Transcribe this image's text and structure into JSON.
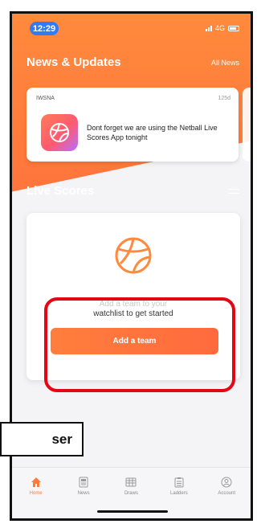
{
  "status_bar": {
    "time": "12:29",
    "network": "4G"
  },
  "news": {
    "title": "News & Updates",
    "all_label": "All News",
    "card": {
      "source": "IWSNA",
      "age": "125d",
      "text": "Dont forget we are using the Netball Live Scores App tonight"
    }
  },
  "live_scores": {
    "title": "Live Scores",
    "empty_text_line1": "Add a team to your",
    "empty_text_line2": "watchlist to get started",
    "add_button_label": "Add a team"
  },
  "annotation": {
    "callout_text": "ser"
  },
  "bottom_nav": {
    "items": [
      {
        "label": "Home",
        "icon": "home-icon",
        "active": true
      },
      {
        "label": "News",
        "icon": "news-icon",
        "active": false
      },
      {
        "label": "Draws",
        "icon": "draws-icon",
        "active": false
      },
      {
        "label": "Ladders",
        "icon": "ladders-icon",
        "active": false
      },
      {
        "label": "Account",
        "icon": "account-icon",
        "active": false
      }
    ]
  },
  "colors": {
    "accent": "#ff7a3b",
    "highlight": "#e40613",
    "time_pill": "#2f7cf6"
  }
}
